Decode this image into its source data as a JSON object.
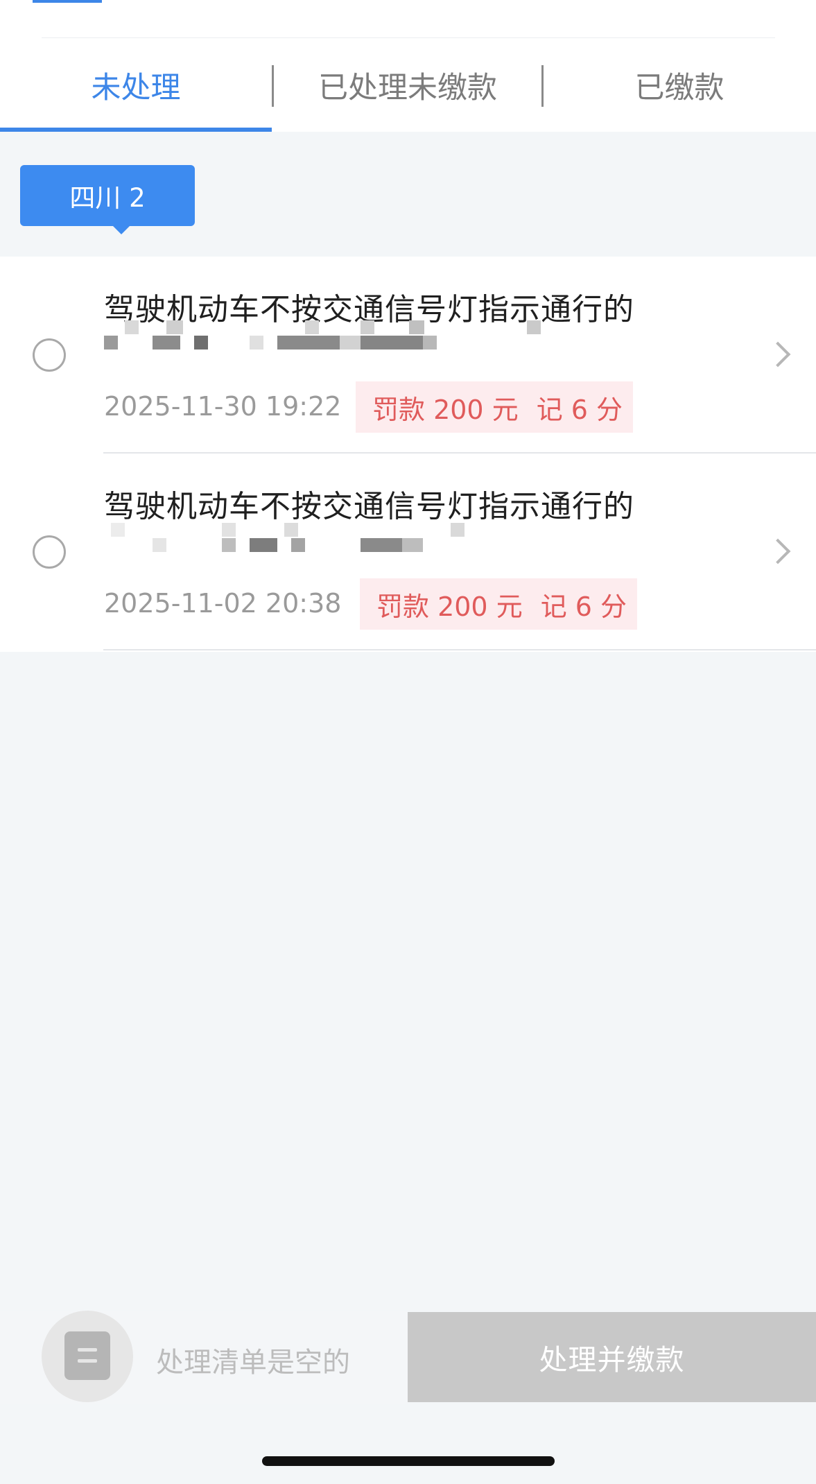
{
  "tabs": [
    {
      "label": "未处理",
      "active": true
    },
    {
      "label": "已处理未缴款",
      "active": false
    },
    {
      "label": "已缴款",
      "active": false
    }
  ],
  "province_badge": "四川 2",
  "violations": [
    {
      "title": "驾驶机动车不按交通信号灯指示通行的",
      "datetime": "2025-11-30 19:22",
      "fine": "罚款 200 元",
      "points": "记 6 分"
    },
    {
      "title": "驾驶机动车不按交通信号灯指示通行的",
      "datetime": "2025-11-02 20:38",
      "fine": "罚款 200 元",
      "points": "记 6 分"
    }
  ],
  "bottom_bar": {
    "empty_text": "处理清单是空的",
    "pay_button": "处理并缴款"
  },
  "icons": {
    "list": "list-icon",
    "chevron": "chevron-right-icon"
  },
  "colors": {
    "accent": "#3d86e8",
    "penalty_text": "#e05b5b",
    "penalty_bg": "#fdecee",
    "disabled_button": "#c8c8c8"
  }
}
